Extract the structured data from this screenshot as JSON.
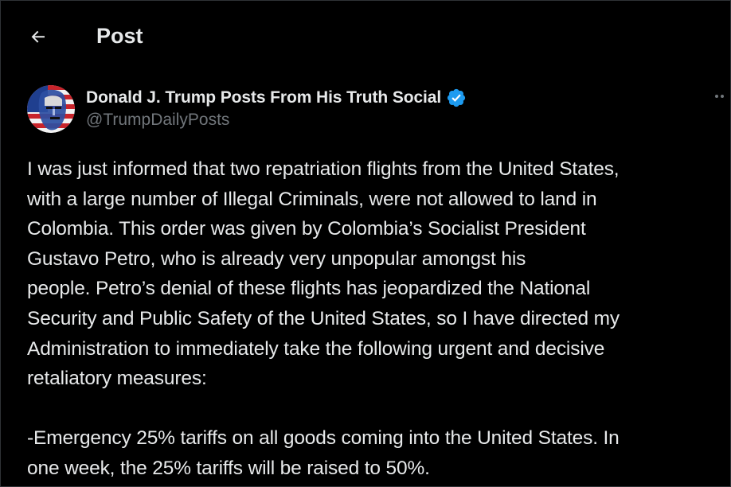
{
  "header": {
    "title": "Post",
    "back_icon": "arrow-left-icon"
  },
  "author": {
    "name": "Donald J. Trump Posts From His Truth Social",
    "handle": "@TrumpDailyPosts",
    "verified_icon": "verified-badge-icon",
    "verified_color": "#1d9bf0"
  },
  "more_icon": "more-horizontal-icon",
  "post": {
    "lines": [
      "I was just informed that two repatriation flights from the United States,",
      "with a large number of Illegal Criminals, were not allowed to land in",
      "Colombia. This order was given by Colombia’s Socialist President",
      "Gustavo Petro, who is already very unpopular amongst his",
      "people. Petro’s denial of these flights has jeopardized the National",
      "Security and Public Safety of the United States, so I have directed my",
      "Administration to immediately take the following urgent and decisive",
      "retaliatory measures:",
      "",
      "-Emergency 25% tariffs on all goods coming into the United States. In",
      "one week, the 25% tariffs will be raised to 50%."
    ]
  },
  "colors": {
    "background": "#000000",
    "text_primary": "#e7e9ea",
    "text_secondary": "#71767b"
  }
}
